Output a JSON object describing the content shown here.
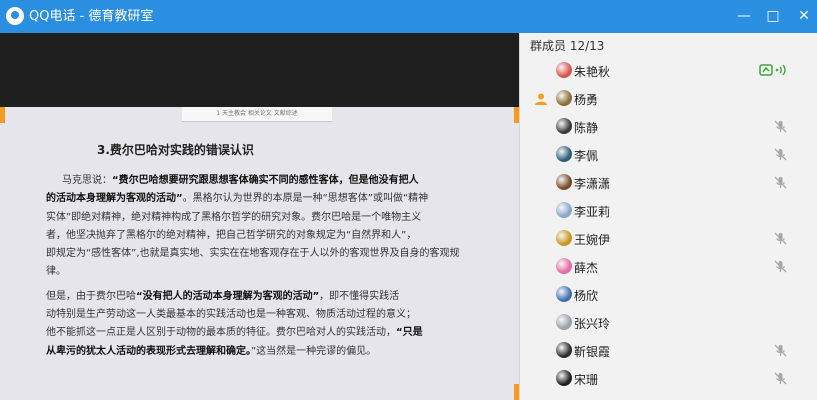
{
  "window": {
    "title": "QQ电话 - 德育教研室",
    "minimize": "—",
    "maximize": "□",
    "close": "✕"
  },
  "document": {
    "header_strip": "1 天主教会   相关论文   文献综述",
    "heading": "3.费尔巴哈对实践的错误认识",
    "lines": [
      {
        "pre": "马克思说：",
        "bold": "“费尔巴哈想要研究跟思想客体确实不同的感性客体，但是他没有把人",
        "post": ""
      },
      {
        "pre": "",
        "bold": "的活动本身理解为客观的活动”",
        "post": "。黑格尔认为世界的本原是一种“思想客体”或叫做“精神"
      },
      {
        "pre": "实体”即绝对精神，绝对精神构成了黑格尔哲学的研究对象。费尔巴哈是一个唯物主义",
        "bold": "",
        "post": ""
      },
      {
        "pre": "者，他坚决抛弃了黑格尔的绝对精神，把自己哲学研究的对象规定为“自然界和人”，",
        "bold": "",
        "post": ""
      },
      {
        "pre": "即规定为“感性客体”,也就是真实地、实实在在地客观存在于人以外的客观世界及自身的客观规",
        "bold": "",
        "post": ""
      },
      {
        "pre": "律。",
        "bold": "",
        "post": ""
      },
      {
        "pre": "    但是，由于费尔巴哈",
        "bold": "“没有把人的活动本身理解为客观的活动”",
        "post": "，即不懂得实践活"
      },
      {
        "pre": "动特别是生产劳动这一人类最基本的实践活动也是一种客观、物质活动过程的意义；",
        "bold": "",
        "post": ""
      },
      {
        "pre": "他不能抓这一点正是人区别于动物的最本质的特征。费尔巴哈对人的实践活动，",
        "bold": "“只是",
        "post": ""
      },
      {
        "pre": "",
        "bold": "从卑污的犹太人活动的表现形式去理解和确定。",
        "post": "”这当然是一种完谬的偏见。"
      }
    ]
  },
  "members": {
    "header": "群成员 12/13",
    "list": [
      {
        "name": "朱艳秋",
        "avatar_color": "#d9534f",
        "speaking": true,
        "muted": false,
        "admin": false
      },
      {
        "name": "杨勇",
        "avatar_color": "#8a6d3b",
        "speaking": false,
        "muted": false,
        "admin": true
      },
      {
        "name": "陈静",
        "avatar_color": "#3a3a3a",
        "speaking": false,
        "muted": true,
        "admin": false
      },
      {
        "name": "李佩",
        "avatar_color": "#2b5f7a",
        "speaking": false,
        "muted": true,
        "admin": false
      },
      {
        "name": "李潇潇",
        "avatar_color": "#7a4a2a",
        "speaking": false,
        "muted": true,
        "admin": false
      },
      {
        "name": "李亚莉",
        "avatar_color": "#8aa6c8",
        "speaking": false,
        "muted": false,
        "admin": false
      },
      {
        "name": "王婉伊",
        "avatar_color": "#c8961e",
        "speaking": false,
        "muted": true,
        "admin": false
      },
      {
        "name": "薛杰",
        "avatar_color": "#e46aa3",
        "speaking": false,
        "muted": true,
        "admin": false
      },
      {
        "name": "杨欣",
        "avatar_color": "#3f6fb0",
        "speaking": false,
        "muted": false,
        "admin": false
      },
      {
        "name": "张兴玲",
        "avatar_color": "#9aa0a8",
        "speaking": false,
        "muted": false,
        "admin": false
      },
      {
        "name": "靳银霞",
        "avatar_color": "#2d2d2d",
        "speaking": false,
        "muted": true,
        "admin": false
      },
      {
        "name": "宋珊",
        "avatar_color": "#1f1f1f",
        "speaking": false,
        "muted": true,
        "admin": false
      }
    ]
  },
  "colors": {
    "titlebar": "#2a8fe0",
    "speaking": "#3aa63a",
    "muted": "#a0a0a0",
    "accent_corner": "#f39a21"
  },
  "icons": {
    "app": "qq-phone-icon",
    "speaking": "speaker-active-icon",
    "muted": "microphone-muted-icon",
    "admin": "admin-user-icon"
  }
}
